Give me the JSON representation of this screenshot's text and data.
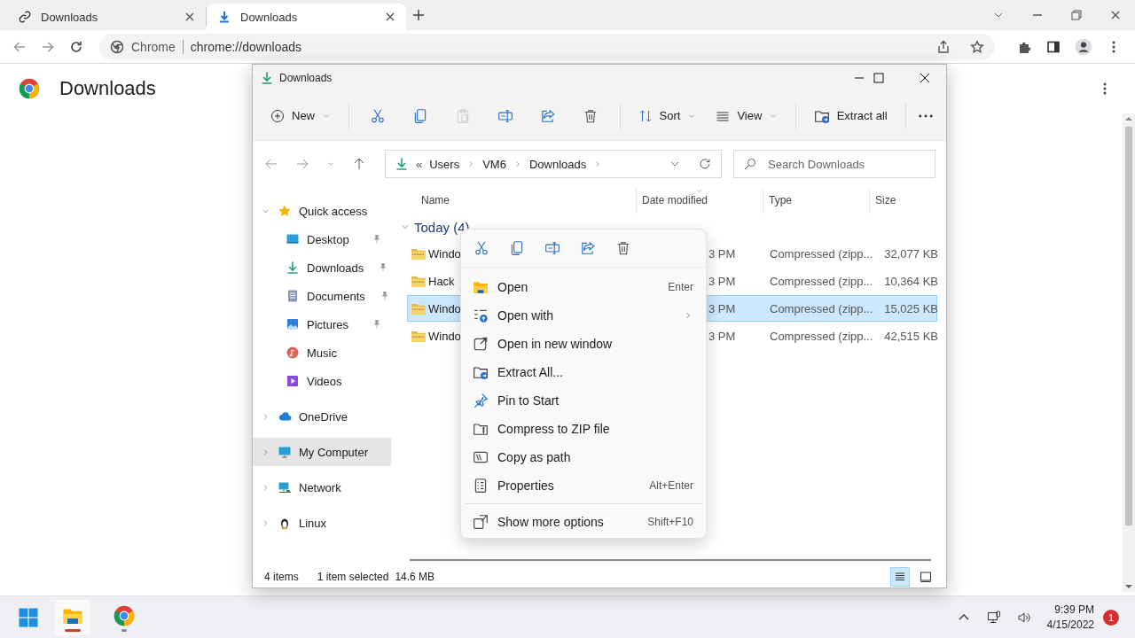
{
  "browser": {
    "tabs": [
      {
        "title": "Downloads",
        "selected": false
      },
      {
        "title": "Downloads",
        "selected": true
      }
    ],
    "omnibox": {
      "site_label": "Chrome",
      "url": "chrome://downloads"
    }
  },
  "page": {
    "title": "Downloads"
  },
  "explorer": {
    "title": "Downloads",
    "toolbar": {
      "new_label": "New",
      "sort_label": "Sort",
      "view_label": "View",
      "extract_label": "Extract all",
      "actions": [
        {
          "disabled": false
        },
        {
          "disabled": false
        },
        {
          "disabled": true
        },
        {
          "disabled": false
        },
        {
          "disabled": false
        },
        {
          "disabled": false
        }
      ]
    },
    "address": {
      "overflow": "«",
      "crumbs": [
        "Users",
        "VM6",
        "Downloads"
      ],
      "search_placeholder": "Search Downloads"
    },
    "nav": [
      {
        "label": "Quick access",
        "expanded": true,
        "selected": false,
        "children": [
          {
            "label": "Desktop",
            "pinned": true
          },
          {
            "label": "Downloads",
            "pinned": true
          },
          {
            "label": "Documents",
            "pinned": true
          },
          {
            "label": "Pictures",
            "pinned": true
          },
          {
            "label": "Music",
            "pinned": false
          },
          {
            "label": "Videos",
            "pinned": false
          }
        ]
      },
      {
        "label": "OneDrive",
        "expanded": false,
        "selected": false
      },
      {
        "label": "My Computer",
        "expanded": false,
        "selected": true
      },
      {
        "label": "Network",
        "expanded": false,
        "selected": false
      },
      {
        "label": "Linux",
        "expanded": false,
        "selected": false
      }
    ],
    "columns": [
      {
        "label": "Name",
        "sorted": false
      },
      {
        "label": "Date modified",
        "sorted": true
      },
      {
        "label": "Type",
        "sorted": false
      },
      {
        "label": "Size",
        "sorted": false
      }
    ],
    "group": {
      "label": "Today (4)",
      "expanded": true
    },
    "files": [
      {
        "name": "Windo",
        "date": "3 PM",
        "type": "Compressed (zipp...",
        "size": "32,077 KB",
        "selected": false
      },
      {
        "name": "Hack",
        "date": "3 PM",
        "type": "Compressed (zipp...",
        "size": "10,364 KB",
        "selected": false
      },
      {
        "name": "Windo",
        "date": "3 PM",
        "type": "Compressed (zipp...",
        "size": "15,025 KB",
        "selected": true
      },
      {
        "name": "Windo",
        "date": "3 PM",
        "type": "Compressed (zipp...",
        "size": "42,515 KB",
        "selected": false
      }
    ],
    "status": {
      "count": "4 items",
      "selection": "1 item selected",
      "size": "14.6 MB",
      "views": [
        {
          "selected": true
        },
        {
          "selected": false
        }
      ]
    }
  },
  "context_menu": {
    "items": [
      {
        "label": "Open",
        "shortcut": "Enter",
        "submenu": false
      },
      {
        "label": "Open with",
        "submenu": true
      },
      {
        "label": "Open in new window",
        "submenu": false
      },
      {
        "label": "Extract All...",
        "submenu": false
      },
      {
        "label": "Pin to Start",
        "submenu": false
      },
      {
        "label": "Compress to ZIP file",
        "submenu": false
      },
      {
        "label": "Copy as path",
        "submenu": false
      },
      {
        "label": "Properties",
        "shortcut": "Alt+Enter",
        "submenu": false
      }
    ],
    "more": {
      "label": "Show more options",
      "shortcut": "Shift+F10"
    }
  },
  "taskbar": {
    "apps": [
      {
        "active": true
      },
      {
        "active": false
      }
    ],
    "time": "9:39 PM",
    "date": "4/15/2022",
    "badge": "1"
  }
}
